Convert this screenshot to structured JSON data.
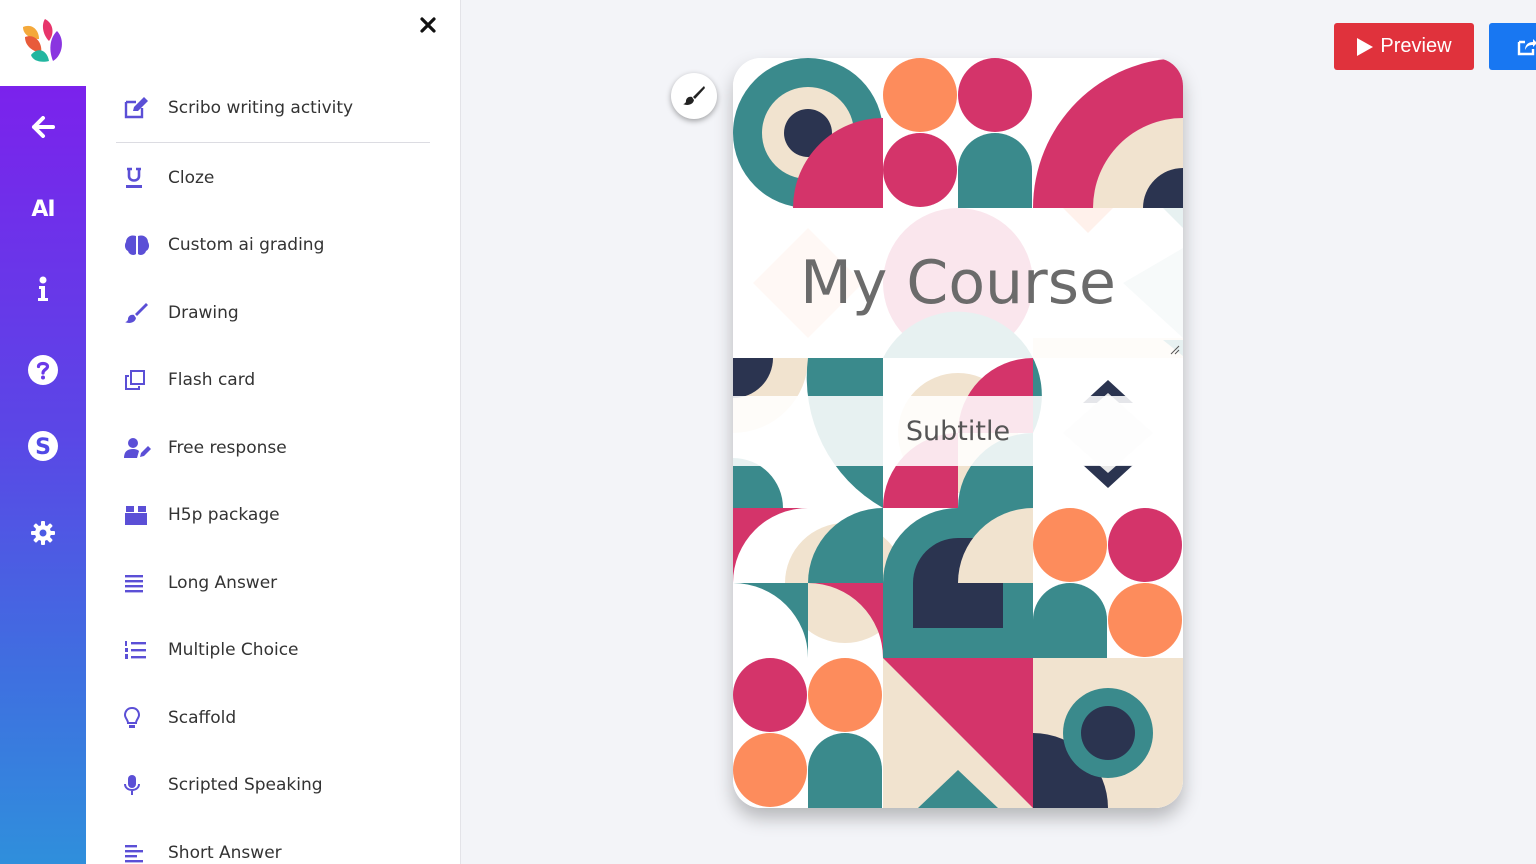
{
  "sidebar": {
    "rail": [
      {
        "name": "back",
        "icon": "arrow-left-icon"
      },
      {
        "name": "ai",
        "label": "AI"
      },
      {
        "name": "info",
        "icon": "info-icon"
      },
      {
        "name": "help",
        "icon": "question-circle-icon"
      },
      {
        "name": "skype",
        "icon": "skype-icon"
      },
      {
        "name": "settings",
        "icon": "gear-icon"
      }
    ],
    "colors": {
      "gradient_top": "#7b22ec",
      "gradient_bottom": "#2f8fdc"
    }
  },
  "panel": {
    "items": [
      {
        "label": "Scribo writing activity",
        "icon": "edit-icon"
      },
      {
        "label": "Cloze",
        "icon": "underline-icon"
      },
      {
        "label": "Custom ai grading",
        "icon": "brain-icon"
      },
      {
        "label": "Drawing",
        "icon": "paintbrush-icon"
      },
      {
        "label": "Flash card",
        "icon": "clone-icon"
      },
      {
        "label": "Free response",
        "icon": "user-edit-icon"
      },
      {
        "label": "H5p package",
        "icon": "box-icon"
      },
      {
        "label": "Long Answer",
        "icon": "align-justify-icon"
      },
      {
        "label": "Multiple Choice",
        "icon": "list-ol-icon"
      },
      {
        "label": "Scaffold",
        "icon": "lightbulb-icon"
      },
      {
        "label": "Scripted Speaking",
        "icon": "microphone-icon"
      },
      {
        "label": "Short Answer",
        "icon": "align-left-icon"
      }
    ],
    "icon_color": "#5b4fd6"
  },
  "toolbar": {
    "preview_label": "Preview",
    "preview_color": "#e0323c",
    "share_color": "#1877f2"
  },
  "card": {
    "title": "My Course",
    "subtitle": "Subtitle",
    "palette": {
      "teal": "#3a8a8c",
      "pink": "#d4346a",
      "orange": "#fd8c5c",
      "cream": "#f1e3cf",
      "navy": "#2b3450"
    }
  }
}
